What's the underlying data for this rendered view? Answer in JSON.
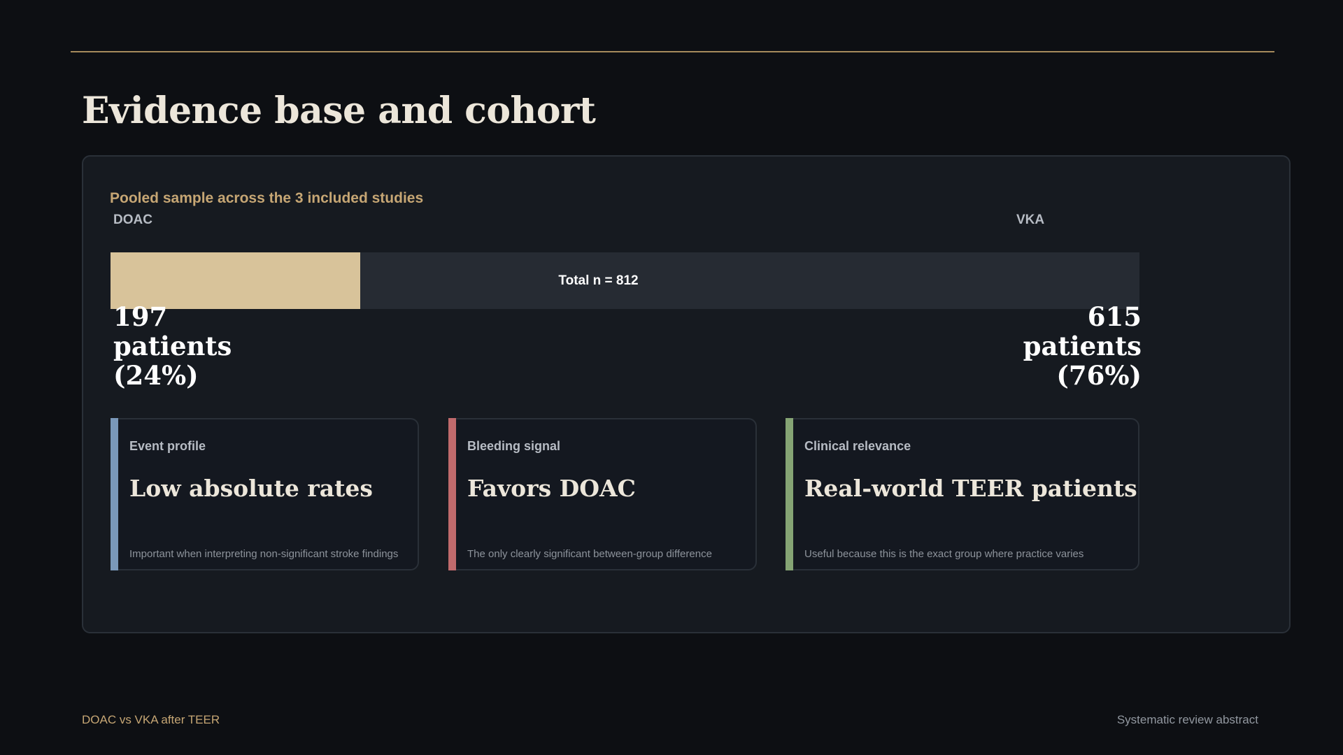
{
  "slide": {
    "title": "Evidence base and cohort",
    "subtitle": "Pooled sample across the 3 included studies",
    "footer_left": "DOAC vs VKA after TEER",
    "footer_right": "Systematic review abstract"
  },
  "colors": {
    "background": "#0d0f13",
    "panel": "#161a20",
    "gold": "#c6a674",
    "doac_fill": "#d8c39a",
    "track": "#262b33",
    "accent_event": "#7a98b9",
    "accent_bleeding": "#c06a6c",
    "accent_clinical": "#85a474"
  },
  "chart_data": {
    "type": "bar",
    "orientation": "horizontal-stacked",
    "total_label": "Total n = 812",
    "total": 812,
    "series": [
      {
        "name": "DOAC",
        "value": 197,
        "percent": 24,
        "display": "197 patients (24%)"
      },
      {
        "name": "VKA",
        "value": 615,
        "percent": 76,
        "display": "615 patients (76%)"
      }
    ]
  },
  "cards": [
    {
      "kicker": "Event profile",
      "headline": "Low absolute rates",
      "note": "Important when interpreting non-significant stroke findings",
      "accent": "#7a98b9"
    },
    {
      "kicker": "Bleeding signal",
      "headline": "Favors DOAC",
      "note": "The only clearly significant between-group difference",
      "accent": "#c06a6c"
    },
    {
      "kicker": "Clinical relevance",
      "headline": "Real-world TEER patients",
      "note": "Useful because this is the exact group where practice varies",
      "accent": "#85a474"
    }
  ]
}
